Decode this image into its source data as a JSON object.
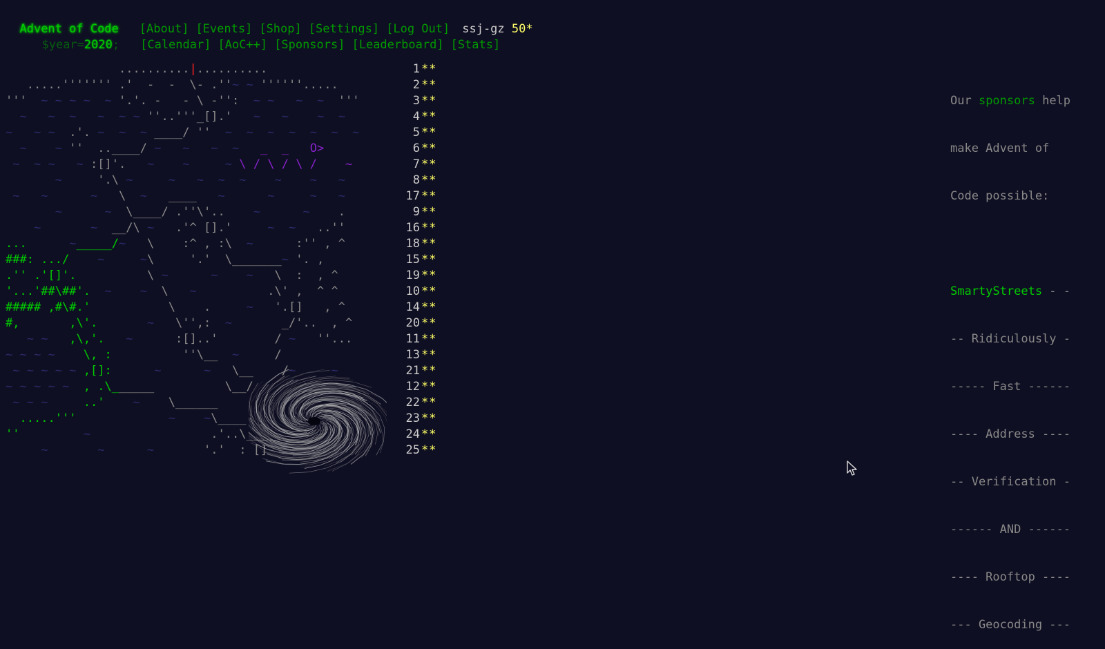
{
  "header": {
    "title": "Advent of Code",
    "year_prefix": "$year=",
    "year": "2020",
    "year_suffix": ";",
    "nav_top": [
      "[About]",
      "[Events]",
      "[Shop]",
      "[Settings]",
      "[Log Out]"
    ],
    "nav_bottom": [
      "[Calendar]",
      "[AoC++]",
      "[Sponsors]",
      "[Leaderboard]",
      "[Stats]"
    ],
    "user": "ssj-gz",
    "stars": "50*"
  },
  "calendar": {
    "rows": [
      {
        "day": "1",
        "stars": "**",
        "art": "                ..........|.........."
      },
      {
        "day": "2",
        "stars": "**",
        "art": "   .....''''''' .'  -  -  \\- .''~ ~ ''''''....."
      },
      {
        "day": "3",
        "stars": "**",
        "art": "'''  ~ ~ ~ ~  ~ '.'. -   - \\ -'':  ~ ~   ~  ~  '''"
      },
      {
        "day": "4",
        "stars": "**",
        "art": "  ~   ~  ~   ~  ~ ~ ''..'''_[].'   ~   ~    ~  ~"
      },
      {
        "day": "5",
        "stars": "**",
        "art": "~   ~ ~  .'. ~  ~  ~ ____/ ''  ~  ~  ~  ~  ~  ~  ~"
      },
      {
        "day": "6",
        "stars": "**",
        "art": "  ~    ~ ''  ..____/ ~   ~   ~  ~   _  _   O>"
      },
      {
        "day": "7",
        "stars": "**",
        "art": " ~  ~ ~   ~ :[]'.   ~    ~     ~ \\ / \\ / \\ /    ~"
      },
      {
        "day": "8",
        "stars": "**",
        "art": "       ~     '.\\ ~     ~   ~  ~  ~    ~    ~   ~"
      },
      {
        "day": "17",
        "stars": "**",
        "art": " ~   ~      ~   \\  ~   ____   ~      ~     ~   ~"
      },
      {
        "day": "9",
        "stars": "**",
        "art": "       ~      ~  \\____/ .''\\'..    ~      ~    ."
      },
      {
        "day": "16",
        "stars": "**",
        "art": "    ~       ~  __/\\ ~   .'^ [].'     ~  ~   ..''"
      },
      {
        "day": "18",
        "stars": "**",
        "art": "...      ~_____/~   \\    :^ , :\\  ~      :'' , ^"
      },
      {
        "day": "15",
        "stars": "**",
        "art": "###: .../    ~     ~\\     '.'  \\_______~ '. ,"
      },
      {
        "day": "19",
        "stars": "**",
        "art": ".'' .'[]'.          \\ ~      ~    ~   \\  :  , ^"
      },
      {
        "day": "10",
        "stars": "**",
        "art": "'...'##\\##'.  ~    ~  \\   ~          .\\' ,  ^ ^"
      },
      {
        "day": "14",
        "stars": "**",
        "art": "##### ,#\\#.'           \\    .     ~   '.[]   , ^"
      },
      {
        "day": "20",
        "stars": "**",
        "art": "#,       ,\\'.       ~   \\'',:  ~       _/'..  , ^"
      },
      {
        "day": "11",
        "stars": "**",
        "art": "   ~ ~   ,\\,'.   ~      :[]..'        / ~   ''..."
      },
      {
        "day": "13",
        "stars": "**",
        "art": "~ ~ ~ ~    \\, :          ''\\__  ~     /"
      },
      {
        "day": "21",
        "stars": "**",
        "art": " ~ ~ ~ ~ ~ ,[]:      ~      ~   \\__    /~     ~"
      },
      {
        "day": "12",
        "stars": "**",
        "art": "~ ~ ~ ~ ~  , .\\______          \\__/"
      },
      {
        "day": "22",
        "stars": "**",
        "art": " ~ ~ ~     ..'    ~    \\______"
      },
      {
        "day": "23",
        "stars": "**",
        "art": "  .....'''             ~    ~\\____"
      },
      {
        "day": "24",
        "stars": "**",
        "art": "''         ~                 .'..\\___"
      },
      {
        "day": "25",
        "stars": "**",
        "art": "     ~       ~      ~       '.'  : []"
      }
    ]
  },
  "sponsor": {
    "intro_pre": "Our ",
    "intro_link": "sponsors",
    "intro_post": " help",
    "intro_line2": "make Advent of",
    "intro_line3": "Code possible:",
    "name": "SmartyStreets",
    "name_suffix": " - -",
    "lines": [
      "-- Ridiculously -",
      "----- Fast ------",
      "---- Address ----",
      "-- Verification -",
      "------ AND ------",
      "---- Rooftop ----",
      "--- Geocoding ---"
    ]
  },
  "colors": {
    "background": "#0f0f23",
    "title": "#00cc00",
    "link": "#009900",
    "star": "#ffff66",
    "water": "#2a2a6a",
    "accent_purple": "#8822cc"
  },
  "icons": {
    "cursor": "mouse-pointer-icon",
    "vortex": "whirlpool-icon"
  }
}
